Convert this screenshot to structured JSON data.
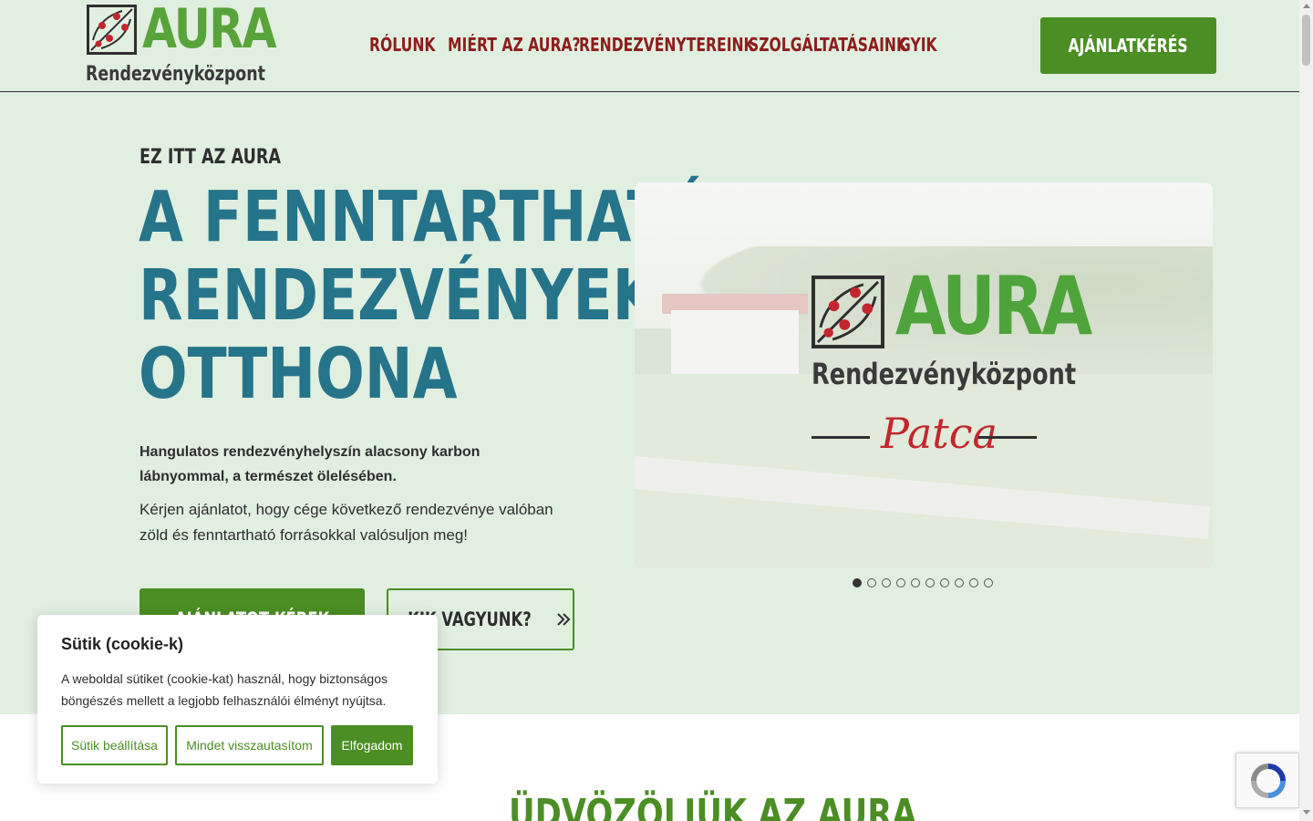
{
  "brand": {
    "logo_word": "AURA",
    "logo_sub": "Rendezvényközpont"
  },
  "nav": {
    "items": [
      {
        "label": "RÓLUNK"
      },
      {
        "label": "MIÉRT AZ AURA?"
      },
      {
        "label": "RENDEZVÉNYTEREINK"
      },
      {
        "label": "SZOLGÁLTATÁSAINK"
      },
      {
        "label": "GYIK"
      }
    ],
    "cta_label": "AJÁNLATKÉRÉS"
  },
  "hero": {
    "eyebrow": "EZ ITT AZ AURA",
    "title_line1": "A FENNTARTHATÓ",
    "title_line2": "RENDEZVÉNYEK",
    "title_line3": "OTTHONA",
    "lead": "Hangulatos rendezvényhelyszín alacsony karbon lábnyommal, a természet ölelésében.",
    "text": "Kérjen ajánlatot, hogy cége következő rendezvénye valóban zöld és fenntartható forrásokkal valósuljon meg!",
    "primary_button": "AJÁNLATOT KÉREK",
    "secondary_button": "KIK VAGYUNK?"
  },
  "slider": {
    "logo_word": "AURA",
    "logo_sub": "Rendezvényközpont",
    "script_text": "Patca",
    "slide_count": 10,
    "active_index": 0
  },
  "welcome": {
    "title": "ÜDVÖZÖLJÜK AZ AURA"
  },
  "cookie": {
    "title": "Sütik (cookie-k)",
    "text": "A weboldal sütiket (cookie-kat) használ, hogy biztonságos böngészés mellett a legjobb felhasználói élményt nyújtsa.",
    "settings_button": "Sütik beállítása",
    "reject_button": "Mindet visszautasítom",
    "accept_button": "Elfogadom"
  },
  "colors": {
    "hero_bg": "#e1efe0",
    "accent_green": "#4b8e24",
    "nav_red": "#8c1d1d",
    "title_teal": "#26748a",
    "logo_dot_red": "#c3262e"
  }
}
